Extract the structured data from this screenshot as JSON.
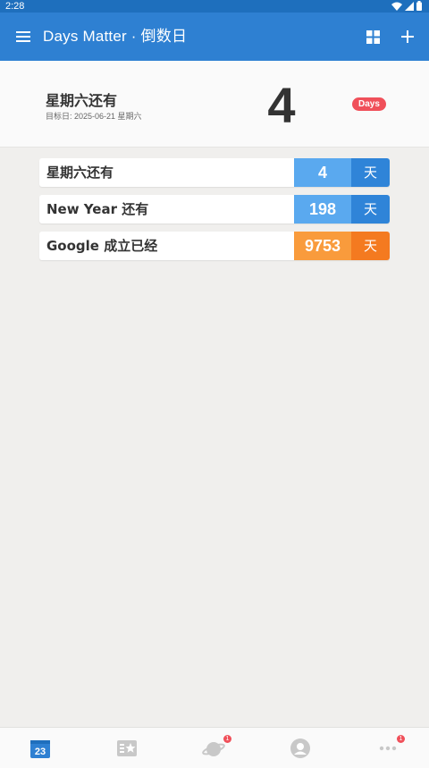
{
  "status_bar": {
    "time": "2:28"
  },
  "app_bar": {
    "title": "Days Matter · 倒数日"
  },
  "hero": {
    "title": "星期六还有",
    "subtitle": "目标日: 2025-06-21 星期六",
    "count": "4",
    "badge": "Days"
  },
  "events": [
    {
      "name": "星期六还有",
      "count": "4",
      "unit": "天",
      "style": "blue"
    },
    {
      "name": "New Year 还有",
      "count": "198",
      "unit": "天",
      "style": "blue"
    },
    {
      "name": "Google 成立已经",
      "count": "9753",
      "unit": "天",
      "style": "orange"
    }
  ],
  "bottom_nav": {
    "calendar_day": "23",
    "planet_badge": "1",
    "more_badge": "1"
  },
  "colors": {
    "primary": "#2e80d2",
    "primary_dark": "#1e6fbd",
    "blue_light": "#5aa9ef",
    "blue_dark": "#2f84d8",
    "orange_light": "#f99b3c",
    "orange_dark": "#f47a20",
    "badge_red": "#f0505a"
  }
}
